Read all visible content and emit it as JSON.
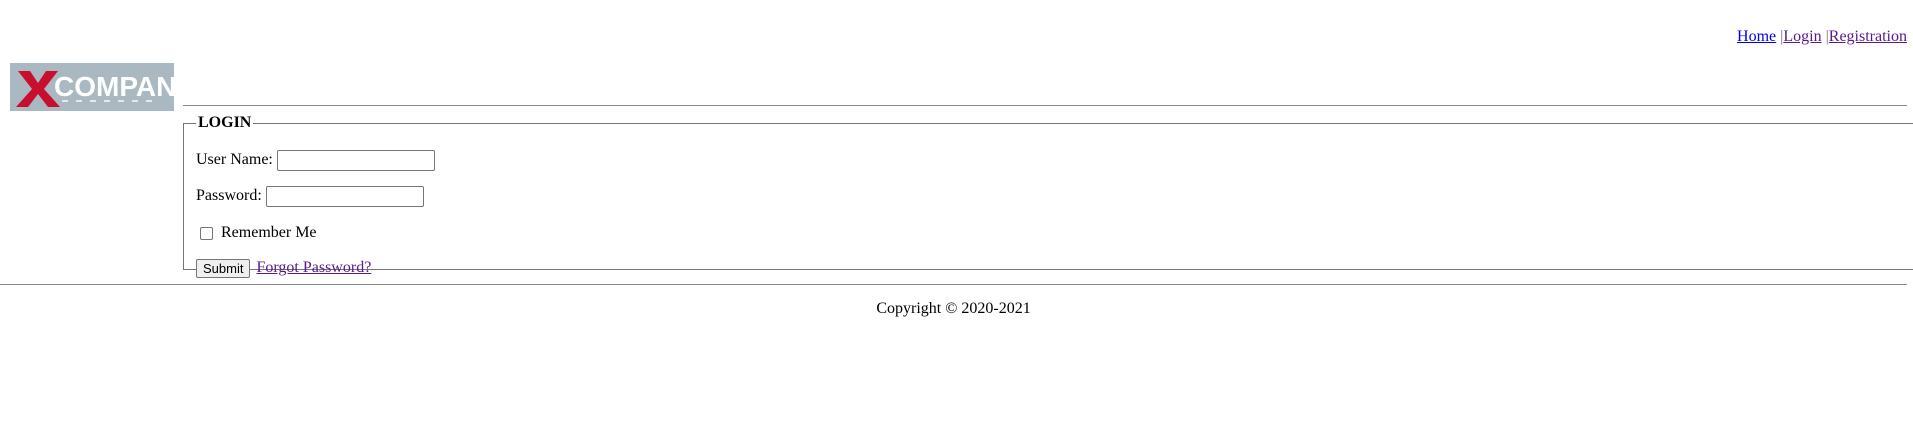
{
  "logo": {
    "text": "COMPANY",
    "letter": "X",
    "colors": {
      "background": "#aab8c2",
      "letter": "#c8102e",
      "text": "#ffffff"
    }
  },
  "nav": {
    "items": [
      {
        "label": "Home"
      },
      {
        "label": "Login"
      },
      {
        "label": "Registration"
      }
    ],
    "separator": "|"
  },
  "login": {
    "legend": "LOGIN",
    "username_label": "User Name:",
    "username_value": "",
    "password_label": "Password:",
    "password_value": "",
    "remember_label": "Remember Me",
    "remember_checked": false,
    "submit_label": "Submit",
    "forgot_label": "Forgot Password?"
  },
  "footer": {
    "copyright": "Copyright © 2020-2021"
  }
}
